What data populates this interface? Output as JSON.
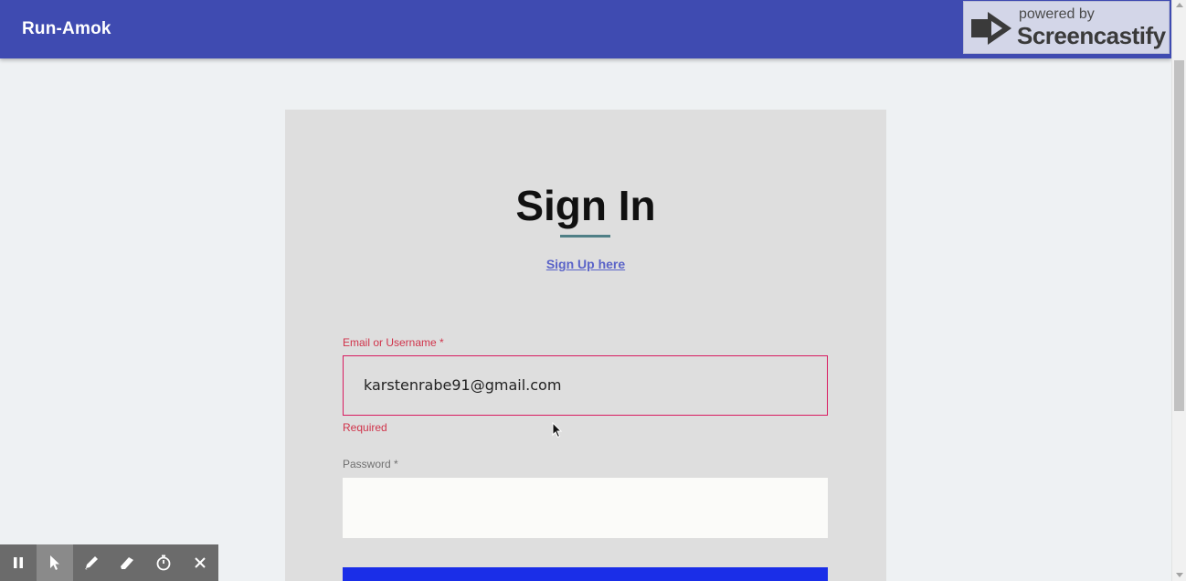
{
  "app": {
    "title": "Run-Amok"
  },
  "watermark": {
    "powered_by": "powered by",
    "brand": "Screencastify"
  },
  "form": {
    "title": "Sign In",
    "signup_link": "Sign Up here",
    "email": {
      "label": "Email or Username *",
      "value": "karstenrabe91@gmail.com",
      "error": "Required"
    },
    "password": {
      "label": "Password *",
      "value": ""
    }
  },
  "colors": {
    "appbar": "#3f4bb1",
    "error": "#d0334a",
    "input_border_error": "#d81b60",
    "link": "#5a63c8",
    "submit": "#1a2ee8"
  },
  "recorder_toolbar": {
    "tools": [
      "pause-icon",
      "cursor-icon",
      "pen-icon",
      "eraser-icon",
      "timer-icon",
      "close-icon"
    ]
  }
}
